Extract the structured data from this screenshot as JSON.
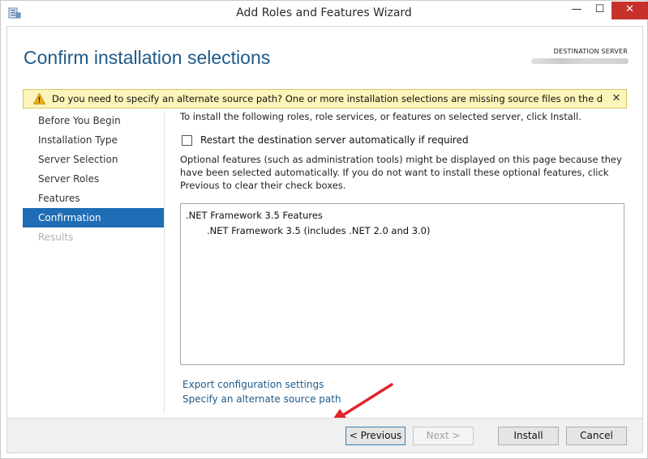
{
  "window": {
    "title": "Add Roles and Features Wizard",
    "minimize": "—",
    "maximize": "☐",
    "close": "✕"
  },
  "header": {
    "heading": "Confirm installation selections",
    "destination_label": "DESTINATION SERVER",
    "destination_value": ""
  },
  "warning": {
    "text": "Do you need to specify an alternate source path? One or more installation selections are missing source files on the destinati...",
    "close": "✕"
  },
  "nav": {
    "items": [
      {
        "label": "Before You Begin"
      },
      {
        "label": "Installation Type"
      },
      {
        "label": "Server Selection"
      },
      {
        "label": "Server Roles"
      },
      {
        "label": "Features"
      },
      {
        "label": "Confirmation"
      },
      {
        "label": "Results"
      }
    ]
  },
  "content": {
    "intro": "To install the following roles, role services, or features on selected server, click Install.",
    "restart_label": "Restart the destination server automatically if required",
    "optional_text": "Optional features (such as administration tools) might be displayed on this page because they have been selected automatically. If you do not want to install these optional features, click Previous to clear their check boxes.",
    "selections": [
      ".NET Framework 3.5 Features",
      ".NET Framework 3.5 (includes .NET 2.0 and 3.0)"
    ],
    "export_link": "Export configuration settings",
    "alternate_link": "Specify an alternate source path"
  },
  "footer": {
    "previous": "< Previous",
    "next": "Next >",
    "install": "Install",
    "cancel": "Cancel"
  },
  "colors": {
    "accent": "#1f6db5",
    "heading": "#1e5a8a",
    "warning_bg": "#fcf4b8",
    "close_button": "#c7312c",
    "arrow": "#e0262a"
  }
}
